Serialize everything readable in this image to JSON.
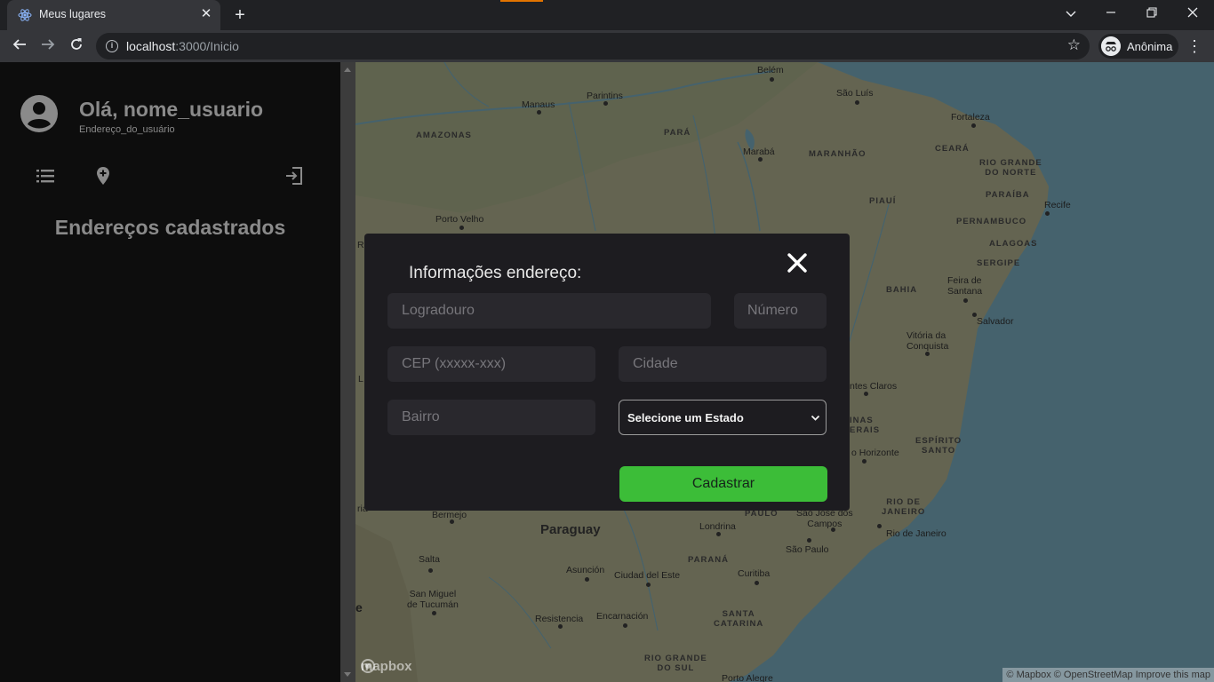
{
  "browser": {
    "tab_title": "Meus lugares",
    "tab_close": "✕",
    "new_tab": "+",
    "url_host": "localhost",
    "url_path": ":3000/Inicio",
    "profile_label": "Anônima"
  },
  "sidebar": {
    "greeting": "Olá, nome_usuario",
    "user_address": "Endereço_do_usuário",
    "section_title": "Endereços cadastrados"
  },
  "map": {
    "labels": {
      "belem": "Belém",
      "sao_luis": "São Luís",
      "manaus": "Manaus",
      "parintins": "Parintins",
      "fortaleza": "Fortaleza",
      "amazonas": "AMAZONAS",
      "para": "PARÁ",
      "ceara": "CEARÁ",
      "maraba": "Marabá",
      "maranhao": "MARANHÃO",
      "rio_grande_do_norte": "RIO GRANDE\nDO NORTE",
      "piaui": "PIAUÍ",
      "paraiba": "PARAÍBA",
      "recife": "Recife",
      "porto_velho": "Porto Velho",
      "pernambuco": "PERNAMBUCO",
      "alagoas": "ALAGOAS",
      "sergipe": "SERGIPE",
      "feira_de_santana": "Feira de\nSantana",
      "bahia": "BAHIA",
      "salvador": "Salvador",
      "vitoria_da_conquista": "Vitória da\nConquista",
      "montes_claros": "ntes Claros",
      "minas_gerais": "INAS\nERAIS",
      "espirito_santo": "ESPÍRITO\nSANTO",
      "belo_horizonte": "o Horizonte",
      "rio_de_janeiro_state": "RIO DE\nJANEIRO",
      "rio_de_janeiro": "Rio de Janeiro",
      "sao_paulo_state": "PAULO",
      "sao_jose_dos_campos": "São José dos\nCampos",
      "sao_paulo": "São Paulo",
      "bermejo": "Bermejo",
      "paraguay": "Paraguay",
      "londrina": "Londrina",
      "salta": "Salta",
      "parana": "PARANÁ",
      "asuncion": "Asunción",
      "curitiba": "Curitiba",
      "ciudad_del_este": "Ciudad del Este",
      "san_miguel": "San Miguel\nde Tucumán",
      "santa_catarina": "SANTA\nCATARINA",
      "resistencia": "Resistencia",
      "encarnacion": "Encarnación",
      "rio_grande_do_sul": "RIO GRANDE\nDO SUL",
      "porto_alegre": "Porto Alegre",
      "edge_l": "L",
      "edge_ria": "ria",
      "edge_e": "e",
      "edge_r": "R"
    },
    "logo": "mapbox",
    "attribution": "© Mapbox © OpenStreetMap  Improve this map",
    "colors": {
      "land": "#b7b794",
      "water": "#7fb3c6"
    }
  },
  "modal": {
    "title": "Informações endereço:",
    "fields": {
      "logradouro": "Logradouro",
      "numero": "Número",
      "cep": "CEP (xxxxx-xxx)",
      "cidade": "Cidade",
      "bairro": "Bairro"
    },
    "estado_select": "Selecione um Estado",
    "submit_label": "Cadastrar",
    "colors": {
      "submit": "#3cbd38",
      "background": "#1d1c20"
    }
  }
}
